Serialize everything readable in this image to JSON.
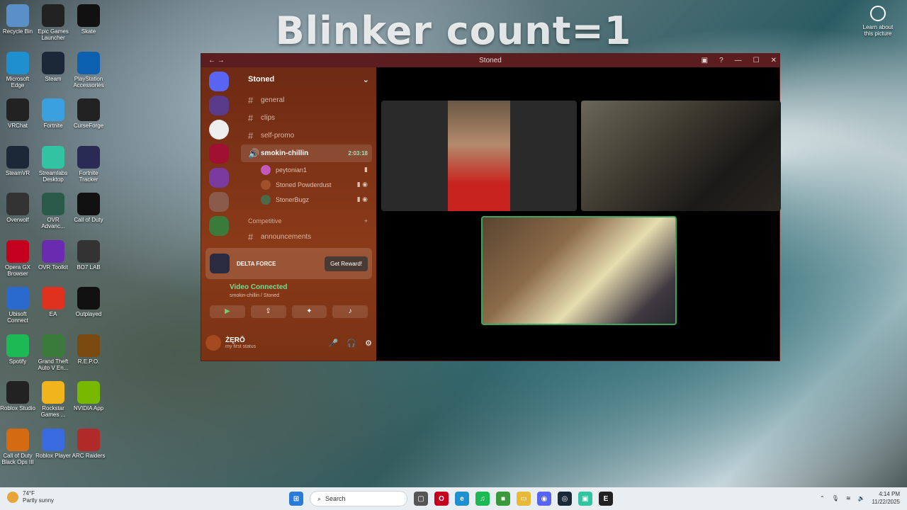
{
  "overlay": {
    "text": "Blinker count=1"
  },
  "desktop": {
    "learn_more": "Learn about this picture",
    "icons": [
      {
        "label": "Recycle Bin",
        "color": "#5b8fc7"
      },
      {
        "label": "Epic Games Launcher",
        "color": "#222222"
      },
      {
        "label": "Skate",
        "color": "#111111"
      },
      {
        "label": "Microsoft Edge",
        "color": "#1f8fcf"
      },
      {
        "label": "Steam",
        "color": "#1b2838"
      },
      {
        "label": "PlayStation Accessories",
        "color": "#0d5fb0"
      },
      {
        "label": "VRChat",
        "color": "#222222"
      },
      {
        "label": "Fortnite",
        "color": "#3ba0e0"
      },
      {
        "label": "CurseForge",
        "color": "#222222"
      },
      {
        "label": "SteamVR",
        "color": "#1b2838"
      },
      {
        "label": "Streamlabs Desktop",
        "color": "#31c3a2"
      },
      {
        "label": "Fortnite Tracker",
        "color": "#2a2a55"
      },
      {
        "label": "Overwolf",
        "color": "#333333"
      },
      {
        "label": "OVR Advanc...",
        "color": "#2a5a4a"
      },
      {
        "label": "Call of Duty",
        "color": "#111111"
      },
      {
        "label": "Opera GX Browser",
        "color": "#c4001e"
      },
      {
        "label": "OVR Toolkit",
        "color": "#6a2bb0"
      },
      {
        "label": "BO7 LAB",
        "color": "#333333"
      },
      {
        "label": "Ubisoft Connect",
        "color": "#2a6acf"
      },
      {
        "label": "EA",
        "color": "#e0301e"
      },
      {
        "label": "Outplayed",
        "color": "#111111"
      },
      {
        "label": "Spotify",
        "color": "#1db954"
      },
      {
        "label": "Grand Theft Auto V En...",
        "color": "#3a7a3a"
      },
      {
        "label": "R.E.P.O.",
        "color": "#7a4a10"
      },
      {
        "label": "Roblox Studio",
        "color": "#222222"
      },
      {
        "label": "Rockstar Games ...",
        "color": "#f2b41c"
      },
      {
        "label": "NVIDIA App",
        "color": "#76b900"
      },
      {
        "label": "Call of Duty Black Ops III",
        "color": "#d46a12"
      },
      {
        "label": "Roblox Player",
        "color": "#3a6ae0"
      },
      {
        "label": "ARC Raiders",
        "color": "#b02a2a"
      }
    ]
  },
  "discord": {
    "window_title": "Stoned",
    "server_name": "Stoned",
    "channels": [
      {
        "name": "general"
      },
      {
        "name": "clips"
      },
      {
        "name": "self-promo"
      }
    ],
    "voice_channel": {
      "name": "smokin-chillin",
      "timer": "2:03:18"
    },
    "voice_users": [
      {
        "name": "peytonian1"
      },
      {
        "name": "Stoned Powderdust"
      },
      {
        "name": "StonerBugz"
      }
    ],
    "category": "Competitive",
    "category_channel": "announcements",
    "promo": {
      "title": "DELTA FORCE",
      "button": "Get Reward!"
    },
    "voice_status": {
      "title": "Video Connected",
      "subtitle": "smokin-chillin / Stoned"
    },
    "user": {
      "name": "ŻĘRŌ",
      "status": "my first status"
    }
  },
  "taskbar": {
    "weather_temp": "74°F",
    "weather_desc": "Partly sunny",
    "search_placeholder": "Search",
    "time": "4:14 PM",
    "date": "11/22/2025"
  }
}
